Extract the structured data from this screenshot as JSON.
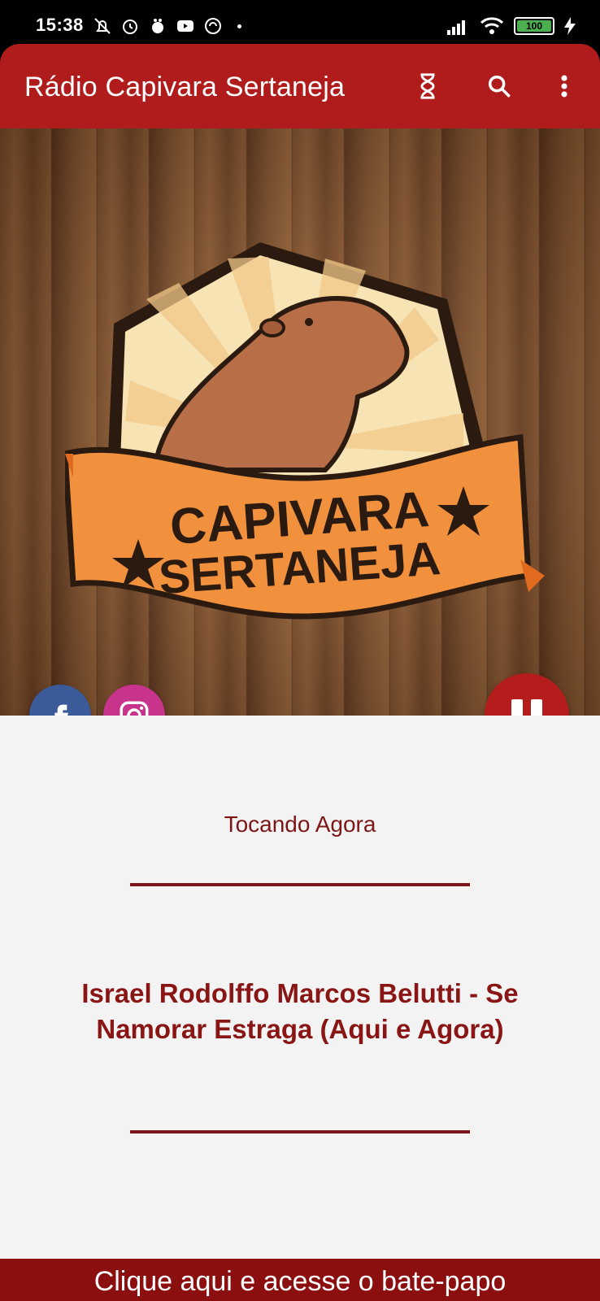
{
  "status_bar": {
    "time": "15:38",
    "battery": "100",
    "left_icons": [
      "mute-icon",
      "alarm-icon",
      "notification-icon",
      "youtube-icon",
      "vpn-icon"
    ],
    "right_icons": [
      "signal-icon",
      "wifi-icon",
      "battery-icon",
      "charging-icon"
    ]
  },
  "app_bar": {
    "title": "Rádio Capivara Sertaneja",
    "actions": [
      "timer-icon",
      "search-icon",
      "more-vert-icon"
    ]
  },
  "logo": {
    "line1": "CAPIVARA",
    "line2": "SERTANEJA"
  },
  "social": [
    "facebook-icon",
    "instagram-icon"
  ],
  "player": {
    "state": "playing",
    "now_playing_label": "Tocando Agora",
    "song": "Israel Rodolffo Marcos Belutti - Se Namorar Estraga (Aqui e Agora)"
  },
  "chat_bar": {
    "label": "Clique aqui e acesse o bate-papo"
  },
  "colors": {
    "primary": "#b01c1c",
    "accent_text": "#7d1717",
    "background": "#f3f3f3",
    "chat_bar": "#8c0f0f"
  }
}
